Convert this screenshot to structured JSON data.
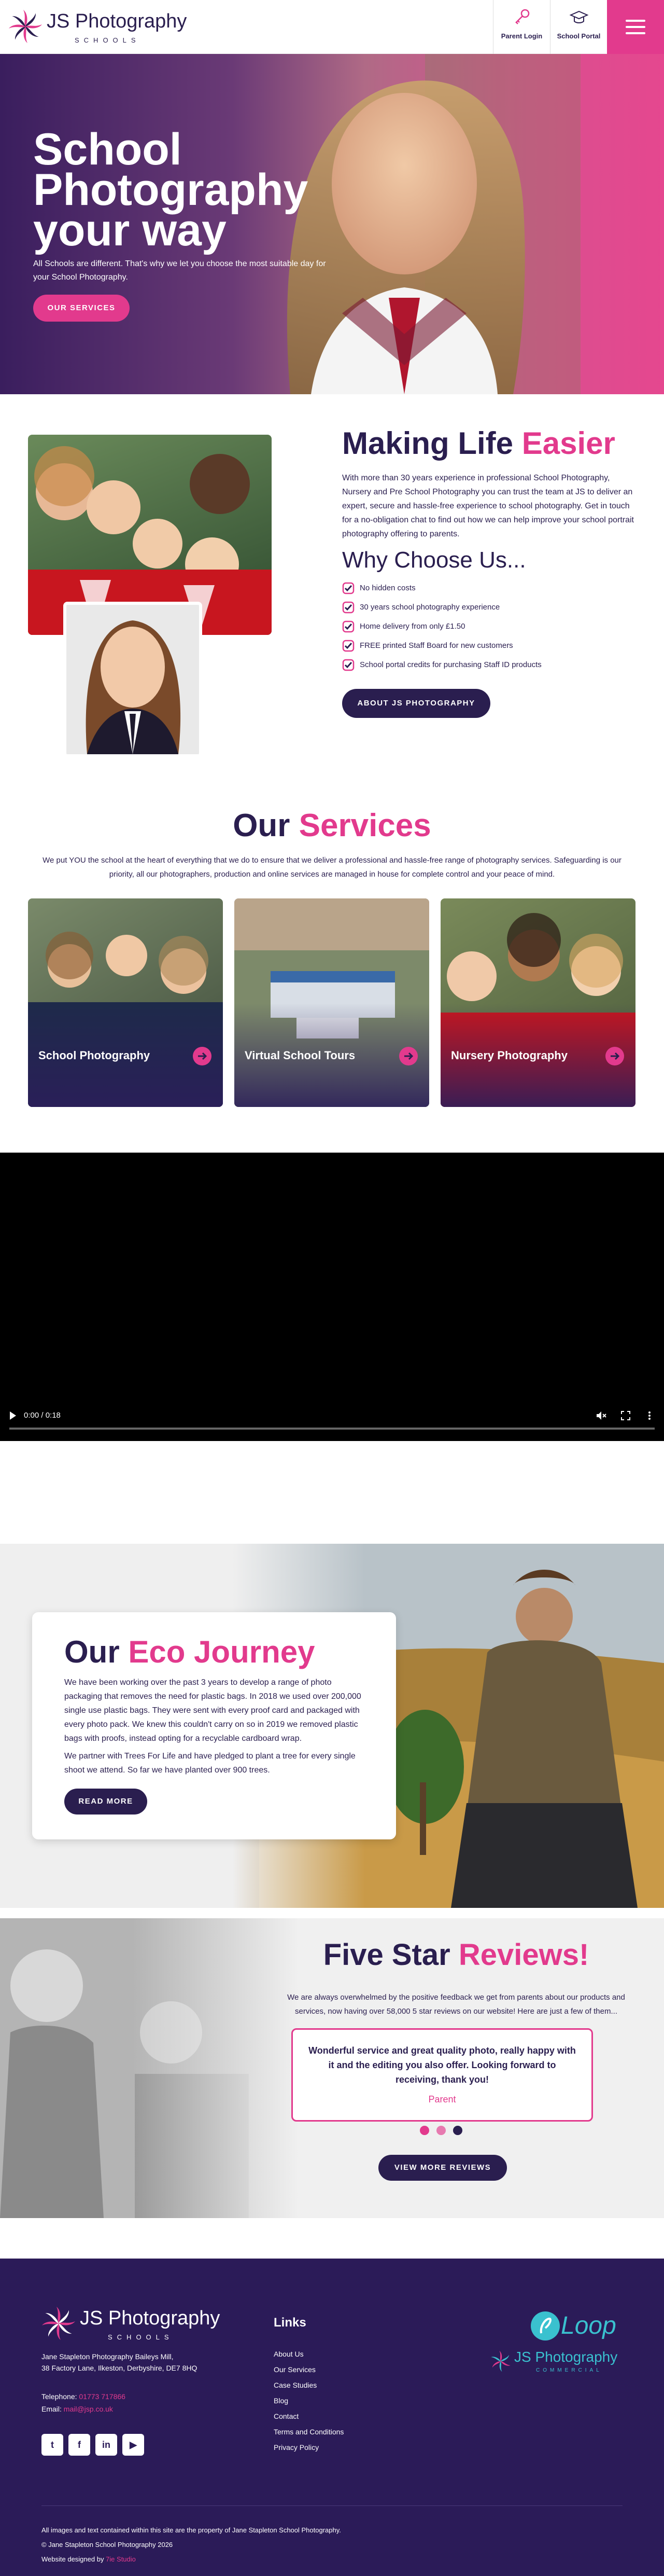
{
  "header": {
    "logo_name": "JS Photography",
    "logo_sub": "SCHOOLS",
    "parent_login": "Parent Login",
    "school_portal": "School Portal",
    "menu_icon": "hamburger-icon"
  },
  "hero": {
    "title": "School Photography your way",
    "text": "All Schools are different. That's why we let you choose the most suitable day for your School Photography.",
    "button": "OUR SERVICES"
  },
  "about": {
    "title_a": "Making Life ",
    "title_b": "Easier",
    "text": "With more than 30 years experience in professional School Photography, Nursery and Pre School Photography you can trust the team at JS to deliver an expert, secure and hassle-free experience to school photography. Get in touch for a no-obligation chat to find out how we can help improve your school portrait photography offering to parents.",
    "why_title": "Why Choose Us...",
    "checks": [
      "No hidden costs",
      "30 years school photography experience",
      "Home delivery from only £1.50",
      "FREE printed Staff Board for new customers",
      "School portal credits for purchasing Staff ID products"
    ],
    "button": "ABOUT JS PHOTOGRAPHY"
  },
  "services": {
    "title_a": "Our ",
    "title_b": "Services",
    "text": "We put YOU the school at the heart of everything that we do to ensure that we deliver a professional and hassle-free range of photography services. Safeguarding is our priority, all our photographers, production and online services are managed in house for complete control and your peace of mind.",
    "cards": [
      {
        "label": "School Photography"
      },
      {
        "label": "Virtual School Tours"
      },
      {
        "label": "Nursery Photography"
      }
    ]
  },
  "video": {
    "time": "0:00 / 0:18",
    "progress": 0
  },
  "eco": {
    "title_a": "Our ",
    "title_b": "Eco Journey",
    "text1": "We have been working over the past 3 years to develop a range of photo packaging that removes the need for plastic bags. In 2018 we used over 200,000 single use plastic bags. They were sent with every proof card and packaged with every photo pack. We knew this couldn't carry on so in 2019 we removed plastic bags with proofs, instead opting for a recyclable cardboard wrap.",
    "text2": "We partner with Trees For Life and have pledged to plant a tree for every single shoot we attend. So far we have planted over 900 trees.",
    "button": "READ MORE"
  },
  "reviews": {
    "title_a": "Five Star ",
    "title_b": "Reviews!",
    "text": "We are always overwhelmed by the positive feedback we get from parents about our products and services, now having over 58,000 5 star reviews on our website! Here are just a few of them...",
    "quote": "Wonderful service and great quality photo, really happy with it and the editing you also offer. Looking forward to receiving, thank you!",
    "author": "Parent",
    "button": "VIEW MORE REVIEWS"
  },
  "footer": {
    "logo_name": "JS Photography",
    "logo_sub": "SCHOOLS",
    "address1": "Jane Stapleton Photography Baileys Mill,",
    "address2": "38 Factory Lane, Ilkeston, Derbyshire, DE7 8HQ",
    "phone_label": "Telephone: ",
    "phone": "01773 717866",
    "email_label": "Email: ",
    "email": "mail@jsp.co.uk",
    "links_title": "Links",
    "links": [
      "About Us",
      "Our Services",
      "Case Studies",
      "Blog",
      "Contact",
      "Terms and Conditions",
      "Privacy Policy"
    ],
    "loop_name": "Loop",
    "commercial_name": "JS Photography",
    "commercial_sub": "COMMERCIAL",
    "copy1": "All images and text contained within this site are the property of Jane Stapleton School Photography.",
    "copy2": "© Jane Stapleton School Photography 2026",
    "designed_label": "Website designed by ",
    "designed_by": "7ie Studio"
  },
  "colors": {
    "primary": "#2a1e4f",
    "accent": "#e23a8d",
    "footer": "#2b1b58"
  }
}
